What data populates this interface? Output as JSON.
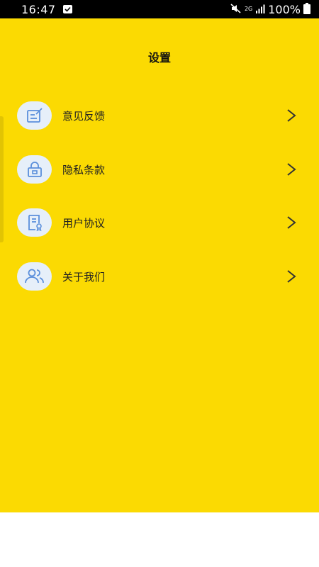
{
  "status_bar": {
    "time": "16:47",
    "network": "2G",
    "battery": "100%"
  },
  "header": {
    "title": "设置"
  },
  "menu": {
    "items": [
      {
        "label": "意见反馈",
        "icon": "feedback-edit-icon"
      },
      {
        "label": "隐私条款",
        "icon": "lock-icon"
      },
      {
        "label": "用户协议",
        "icon": "document-certificate-icon"
      },
      {
        "label": "关于我们",
        "icon": "users-icon"
      }
    ]
  },
  "colors": {
    "background": "#fbda02",
    "icon_bg": "#e6eff9",
    "icon_stroke": "#5b8fdb",
    "text": "#222222"
  }
}
